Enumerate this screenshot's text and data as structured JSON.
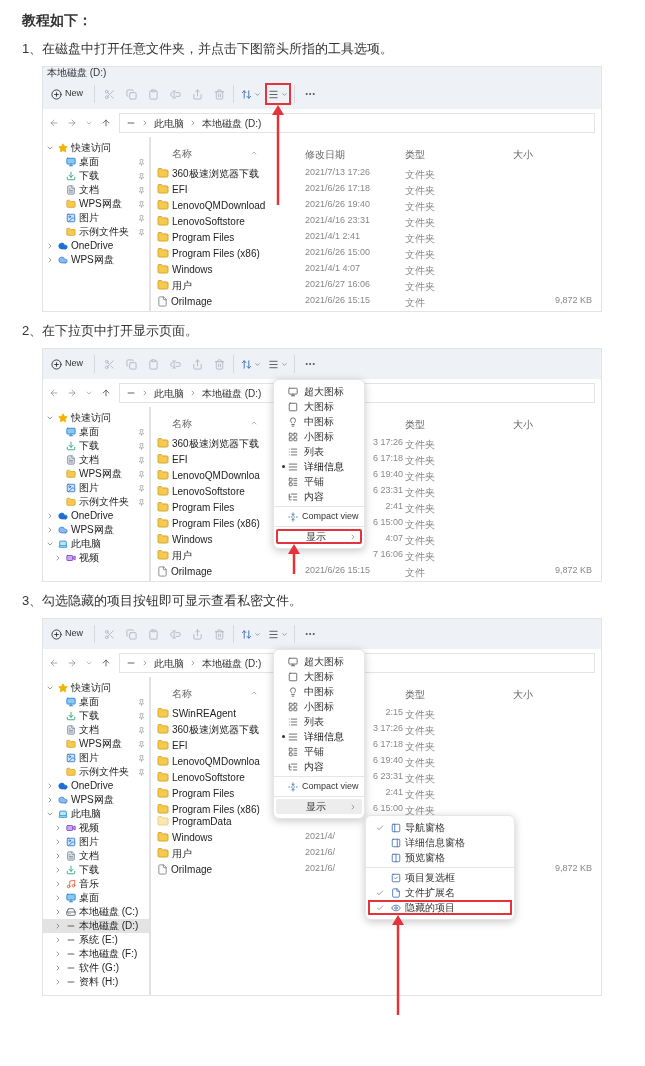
{
  "heading": "教程如下：",
  "steps": [
    {
      "text": "1、在磁盘中打开任意文件夹，并点击下图箭头所指的工具选项。",
      "explorer": {
        "title": "本地磁盘 (D:)",
        "toolbar": {
          "new_label": "New",
          "view_highlighted": true
        },
        "breadcrumb": [
          "此电脑",
          "本地磁盘 (D:)"
        ],
        "sidebar": [
          {
            "label": "快速访问",
            "kind": "star",
            "selected": false,
            "expanded": true,
            "children": [
              {
                "label": "桌面",
                "kind": "desktop",
                "selected": false,
                "pinned": true
              },
              {
                "label": "下载",
                "kind": "download",
                "selected": false,
                "pinned": true
              },
              {
                "label": "文档",
                "kind": "document",
                "selected": false,
                "pinned": true
              },
              {
                "label": "WPS网盘",
                "kind": "folder",
                "selected": false,
                "pinned": true
              },
              {
                "label": "图片",
                "kind": "pictures",
                "selected": false,
                "pinned": true
              },
              {
                "label": "示例文件夹",
                "kind": "folder",
                "selected": false,
                "pinned": true
              }
            ]
          },
          {
            "label": "OneDrive",
            "kind": "cloud",
            "selected": false,
            "expanded": false
          },
          {
            "label": "WPS网盘",
            "kind": "wps",
            "selected": false,
            "expanded": false
          }
        ],
        "header": {
          "name": "名称",
          "date": "修改日期",
          "type": "类型",
          "size": "大小"
        },
        "files": [
          {
            "name": "360极速浏览器下载",
            "kind": "folder",
            "date": "2021/7/13 17:26",
            "type": "文件夹"
          },
          {
            "name": "EFI",
            "kind": "folder",
            "date": "2021/6/26 17:18",
            "type": "文件夹"
          },
          {
            "name": "LenovoQMDownload",
            "kind": "folder",
            "date": "2021/6/26 19:40",
            "type": "文件夹"
          },
          {
            "name": "LenovoSoftstore",
            "kind": "folder",
            "date": "2021/4/16 23:31",
            "type": "文件夹"
          },
          {
            "name": "Program Files",
            "kind": "folder",
            "date": "2021/4/1 2:41",
            "type": "文件夹"
          },
          {
            "name": "Program Files (x86)",
            "kind": "folder",
            "date": "2021/6/26 15:00",
            "type": "文件夹"
          },
          {
            "name": "Windows",
            "kind": "folder",
            "date": "2021/4/1 4:07",
            "type": "文件夹"
          },
          {
            "name": "用户",
            "kind": "folder",
            "date": "2021/6/27 16:06",
            "type": "文件夹"
          },
          {
            "name": "OriImage",
            "kind": "file",
            "date": "2021/6/26 15:15",
            "type": "文件",
            "size": "9,872 KB"
          }
        ]
      }
    },
    {
      "text": "2、在下拉页中打开显示页面。",
      "explorer": {
        "toolbar": {
          "new_label": "New",
          "view_highlighted": false
        },
        "breadcrumb": [
          "此电脑",
          "本地磁盘 (D:)"
        ],
        "sidebar": [
          {
            "label": "快速访问",
            "kind": "star",
            "selected": false,
            "expanded": true,
            "children": [
              {
                "label": "桌面",
                "kind": "desktop",
                "selected": false,
                "pinned": true
              },
              {
                "label": "下载",
                "kind": "download",
                "selected": false,
                "pinned": true
              },
              {
                "label": "文档",
                "kind": "document",
                "selected": false,
                "pinned": true
              },
              {
                "label": "WPS网盘",
                "kind": "folder",
                "selected": false,
                "pinned": true
              },
              {
                "label": "图片",
                "kind": "pictures",
                "selected": false,
                "pinned": true
              },
              {
                "label": "示例文件夹",
                "kind": "folder",
                "selected": false,
                "pinned": true
              }
            ]
          },
          {
            "label": "OneDrive",
            "kind": "cloud",
            "selected": false,
            "expanded": false
          },
          {
            "label": "WPS网盘",
            "kind": "wps",
            "selected": false,
            "expanded": false
          },
          {
            "label": "此电脑",
            "kind": "pc",
            "selected": false,
            "expanded": true,
            "children": [
              {
                "label": "视频",
                "kind": "video",
                "selected": false,
                "expanded": false
              }
            ]
          }
        ],
        "header": {
          "name": "名称",
          "type": "类型",
          "size": "大小"
        },
        "files": [
          {
            "name": "360极速浏览器下载",
            "kind": "folder",
            "date": "3 17:26",
            "date_partly_hidden": true,
            "type": "文件夹"
          },
          {
            "name": "EFI",
            "kind": "folder",
            "date": "6 17:18",
            "date_partly_hidden": true,
            "type": "文件夹"
          },
          {
            "name": "LenovoQMDownloa",
            "kind": "folder",
            "date": "6 19:40",
            "date_partly_hidden": true,
            "type": "文件夹"
          },
          {
            "name": "LenovoSoftstore",
            "kind": "folder",
            "date": "6 23:31",
            "date_partly_hidden": true,
            "type": "文件夹"
          },
          {
            "name": "Program Files",
            "kind": "folder",
            "date": "2:41",
            "date_partly_hidden": true,
            "type": "文件夹"
          },
          {
            "name": "Program Files (x86)",
            "kind": "folder",
            "date": "6 15:00",
            "date_partly_hidden": true,
            "type": "文件夹"
          },
          {
            "name": "Windows",
            "kind": "folder",
            "date": "4:07",
            "date_partly_hidden": true,
            "type": "文件夹"
          },
          {
            "name": "用户",
            "kind": "folder",
            "date": "7 16:06",
            "date_partly_hidden": true,
            "type": "文件夹"
          },
          {
            "name": "OriImage",
            "kind": "file",
            "date": "2021/6/26 15:15",
            "type": "文件",
            "size": "9,872 KB"
          }
        ],
        "view_menu": {
          "views": [
            {
              "label": "超大图标",
              "kind": "extra-large",
              "selected": false
            },
            {
              "label": "大图标",
              "kind": "large",
              "selected": false
            },
            {
              "label": "中图标",
              "kind": "medium",
              "selected": false
            },
            {
              "label": "小图标",
              "kind": "small",
              "selected": false
            },
            {
              "label": "列表",
              "kind": "list",
              "selected": false
            },
            {
              "label": "详细信息",
              "kind": "details",
              "selected": true
            },
            {
              "label": "平铺",
              "kind": "tiles",
              "selected": false
            },
            {
              "label": "内容",
              "kind": "content",
              "selected": false
            }
          ],
          "compact": {
            "label": "Compact view"
          },
          "show": {
            "label": "显示",
            "highlighted": true
          }
        }
      }
    },
    {
      "text": "3、勾选隐藏的项目按钮即可显示查看私密文件。",
      "explorer": {
        "toolbar": {
          "new_label": "New",
          "view_highlighted": false
        },
        "breadcrumb": [
          "此电脑",
          "本地磁盘 (D:)"
        ],
        "sidebar": [
          {
            "label": "快速访问",
            "kind": "star",
            "selected": false,
            "expanded": true,
            "children": [
              {
                "label": "桌面",
                "kind": "desktop",
                "selected": false,
                "pinned": true
              },
              {
                "label": "下载",
                "kind": "download",
                "selected": false,
                "pinned": true
              },
              {
                "label": "文档",
                "kind": "document",
                "selected": false,
                "pinned": true
              },
              {
                "label": "WPS网盘",
                "kind": "folder",
                "selected": false,
                "pinned": true
              },
              {
                "label": "图片",
                "kind": "pictures",
                "selected": false,
                "pinned": true
              },
              {
                "label": "示例文件夹",
                "kind": "folder",
                "selected": false,
                "pinned": true
              }
            ]
          },
          {
            "label": "OneDrive",
            "kind": "cloud",
            "selected": false,
            "expanded": false
          },
          {
            "label": "WPS网盘",
            "kind": "wps",
            "selected": false,
            "expanded": false
          },
          {
            "label": "此电脑",
            "kind": "pc",
            "selected": false,
            "expanded": true,
            "children": [
              {
                "label": "视频",
                "kind": "video",
                "selected": false,
                "expanded": false
              },
              {
                "label": "图片",
                "kind": "pictures",
                "selected": false,
                "expanded": false
              },
              {
                "label": "文档",
                "kind": "document",
                "selected": false,
                "expanded": false
              },
              {
                "label": "下载",
                "kind": "download",
                "selected": false,
                "expanded": false
              },
              {
                "label": "音乐",
                "kind": "music",
                "selected": false,
                "expanded": false
              },
              {
                "label": "桌面",
                "kind": "desktop",
                "selected": false,
                "expanded": false
              },
              {
                "label": "本地磁盘 (C:)",
                "kind": "system-drive",
                "selected": false,
                "expanded": false
              },
              {
                "label": "本地磁盘 (D:)",
                "kind": "drive",
                "selected": true,
                "expanded": false
              },
              {
                "label": "系统 (E:)",
                "kind": "drive",
                "selected": false,
                "expanded": false
              },
              {
                "label": "本地磁盘 (F:)",
                "kind": "drive",
                "selected": false,
                "expanded": false
              },
              {
                "label": "软件 (G:)",
                "kind": "drive",
                "selected": false,
                "expanded": false
              },
              {
                "label": "资料 (H:)",
                "kind": "drive",
                "selected": false,
                "expanded": false
              }
            ]
          }
        ],
        "header": {
          "name": "名称",
          "type": "类型",
          "size": "大小"
        },
        "files": [
          {
            "name": "SWinREAgent",
            "kind": "folder",
            "date": "2:15",
            "date_partly_hidden": true,
            "type": "文件夹"
          },
          {
            "name": "360极速浏览器下载",
            "kind": "folder",
            "date": "3 17:26",
            "date_partly_hidden": true,
            "type": "文件夹"
          },
          {
            "name": "EFI",
            "kind": "folder",
            "date": "6 17:18",
            "date_partly_hidden": true,
            "type": "文件夹"
          },
          {
            "name": "LenovoQMDownloa",
            "kind": "folder",
            "date": "6 19:40",
            "date_partly_hidden": true,
            "type": "文件夹"
          },
          {
            "name": "LenovoSoftstore",
            "kind": "folder",
            "date": "6 23:31",
            "date_partly_hidden": true,
            "type": "文件夹"
          },
          {
            "name": "Program Files",
            "kind": "folder",
            "date": "2:41",
            "date_partly_hidden": true,
            "type": "文件夹"
          },
          {
            "name": "Program Files (x86)",
            "kind": "folder",
            "date": "6 15:00",
            "date_partly_hidden": true,
            "type": "文件夹"
          },
          {
            "name": "ProgramData",
            "kind": "hidden-folder"
          },
          {
            "name": "Windows",
            "kind": "folder",
            "date": "2021/4/"
          },
          {
            "name": "用户",
            "kind": "folder",
            "date": "2021/6/"
          },
          {
            "name": "OriImage",
            "kind": "file",
            "date": "2021/6/",
            "size": "9,872 KB"
          }
        ],
        "view_menu": {
          "views": [
            {
              "label": "超大图标",
              "kind": "extra-large",
              "selected": false
            },
            {
              "label": "大图标",
              "kind": "large",
              "selected": false
            },
            {
              "label": "中图标",
              "kind": "medium",
              "selected": false
            },
            {
              "label": "小图标",
              "kind": "small",
              "selected": false
            },
            {
              "label": "列表",
              "kind": "list",
              "selected": false
            },
            {
              "label": "详细信息",
              "kind": "details",
              "selected": true
            },
            {
              "label": "平铺",
              "kind": "tiles",
              "selected": false
            },
            {
              "label": "内容",
              "kind": "content",
              "selected": false
            }
          ],
          "compact": {
            "label": "Compact view"
          },
          "show": {
            "label": "显示",
            "highlighted": false
          }
        },
        "show_menu": {
          "panes": [
            {
              "label": "导航窗格",
              "kind": "navigation",
              "checked": true,
              "highlighted": false
            },
            {
              "label": "详细信息窗格",
              "kind": "details",
              "checked": false,
              "highlighted": false
            },
            {
              "label": "预览窗格",
              "kind": "preview",
              "checked": false,
              "highlighted": false
            }
          ],
          "options": [
            {
              "label": "项目复选框",
              "kind": "checkboxes",
              "checked": false,
              "highlighted": false
            },
            {
              "label": "文件扩展名",
              "kind": "extensions",
              "checked": true,
              "highlighted": false
            },
            {
              "label": "隐藏的项目",
              "kind": "hidden",
              "checked": true,
              "highlighted": true
            }
          ]
        }
      }
    }
  ]
}
